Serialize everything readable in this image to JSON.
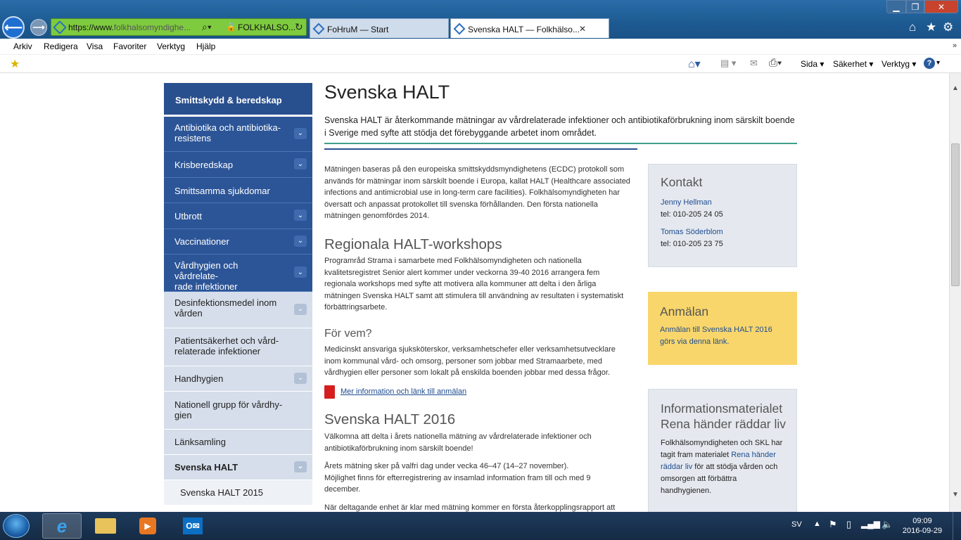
{
  "browser": {
    "address_url_main": "https://www.",
    "address_url_domain": "folkhalsomyndighe...",
    "security_label": "FOLKHALSO...",
    "tabs": [
      {
        "label": "FoHruM — Start"
      },
      {
        "label": "Svenska HALT — Folkhälso..."
      }
    ],
    "menu": [
      "Arkiv",
      "Redigera",
      "Visa",
      "Favoriter",
      "Verktyg",
      "Hjälp"
    ],
    "toolbar": {
      "sida": "Sida",
      "sakerhet": "Säkerhet",
      "verktyg": "Verktyg"
    }
  },
  "sidebar": {
    "header": "Smittskydd & beredskap",
    "items": [
      {
        "line1": "Antibiotika och antibiotika-",
        "line2": "resistens"
      },
      {
        "line1": "Krisberedskap",
        "line2": ""
      },
      {
        "line1": "Smittsamma sjukdomar",
        "line2": ""
      },
      {
        "line1": "Utbrott",
        "line2": ""
      },
      {
        "line1": "Vaccinationer",
        "line2": ""
      },
      {
        "line1": "Vårdhygien och vårdrelate-",
        "line2": "rade infektioner"
      },
      {
        "line1": "Desinfektionsmedel inom",
        "line2": "vården"
      },
      {
        "line1": "Patientsäkerhet och vård-",
        "line2": "relaterade infektioner"
      },
      {
        "line1": "Handhygien",
        "line2": ""
      },
      {
        "line1": "Nationell grupp för vårdhy-",
        "line2": "gien"
      },
      {
        "line1": "Länksamling",
        "line2": ""
      },
      {
        "line1": "Svenska HALT",
        "line2": ""
      },
      {
        "line1": "Svenska HALT 2015",
        "line2": ""
      }
    ]
  },
  "content": {
    "title": "Svenska HALT",
    "intro_l1": "Svenska HALT är återkommande mätningar av vårdrelaterade infektioner och antibiotikaförbrukning inom särskilt boende",
    "intro_l2": "i Sverige med syfte att stödja det förebyggande arbetet inom området.",
    "p1": [
      "Mätningen baseras på den europeiska smittskyddsmyndighetens (ECDC) protokoll som",
      "används för mätningar inom särskilt boende i Europa, kallat HALT (Healthcare associated",
      "infections and antimicrobial use in long-term care facilities). Folkhälsomyndigheten har",
      "översatt och anpassat protokollet till svenska förhållanden. Den första nationella",
      "mätningen genomfördes 2014."
    ],
    "h_workshops": "Regionala HALT-workshops",
    "p2": [
      "Programråd Strama i samarbete med Folkhälsomyndigheten och nationella",
      "kvalitetsregistret Senior alert kommer under veckorna 39-40 2016 arrangera fem",
      "regionala workshops med syfte att motivera alla kommuner att delta i den årliga",
      "mätningen Svenska HALT samt att stimulera till användning av resultaten i systematiskt",
      "förbättringsarbete."
    ],
    "h_forvem": "För vem?",
    "p3": [
      "Medicinskt ansvariga sjuksköterskor, verksamhetschefer eller verksamhetsutvecklare",
      "inom kommunal vård- och omsorg, personer som jobbar med Stramaarbete, med",
      "vårdhygien eller personer som lokalt på enskilda boenden jobbar med dessa frågor."
    ],
    "pdf_link": "Mer information och länk till anmälan",
    "h_2016": "Svenska HALT 2016",
    "p4": [
      "Välkomna att delta i årets nationella mätning av vårdrelaterade infektioner och",
      "antibiotikaförbrukning inom särskilt boende!"
    ],
    "p5": [
      "Årets mätning sker på valfri dag under vecka 46–47 (14–27 november).",
      "Möjlighet finns för efterregistrering av insamlad information fram till och med 9",
      "december."
    ],
    "p6": "När deltagande enhet är klar med mätning kommer en första återkopplingsrapport att"
  },
  "kontakt": {
    "title": "Kontakt",
    "people": [
      {
        "name": "Jenny Hellman",
        "tel": "tel: 010-205 24 05"
      },
      {
        "name": "Tomas Söderblom",
        "tel": "tel: 010-205 23 75"
      }
    ]
  },
  "anmalan": {
    "title": "Anmälan",
    "link_l1": "Anmälan till Svenska HALT 2016",
    "link_l2": "görs via denna länk."
  },
  "info": {
    "title_l1": "Informationsmaterialet",
    "title_l2": "Rena händer räddar liv",
    "t1": "Folkhälsomyndigheten och SKL har",
    "t2": "tagit fram materialet",
    "link_a": "Rena händer",
    "link_b": "räddar liv",
    "t3": " för att stödja vården och",
    "t4": "omsorgen att förbättra",
    "t5": "handhygienen."
  },
  "taskbar": {
    "lang": "SV",
    "time": "09:09",
    "date": "2016-09-29"
  },
  "colors": {
    "sidebar_dark": "#2c5597",
    "sidebar_light": "#d6deeb",
    "accent_green": "#3ea08c",
    "anmalan_bg": "#f9d66b"
  }
}
